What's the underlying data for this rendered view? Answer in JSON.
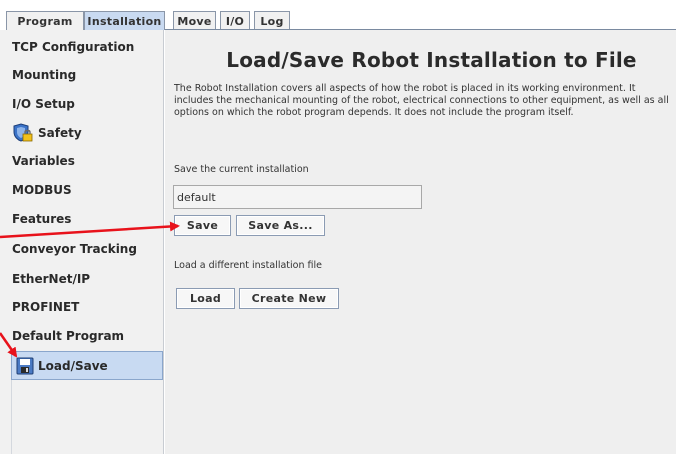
{
  "tabs": [
    {
      "label": "Program",
      "active": false
    },
    {
      "label": "Installation",
      "active": true
    },
    {
      "label": "Move",
      "active": false
    },
    {
      "label": "I/O",
      "active": false
    },
    {
      "label": "Log",
      "active": false
    }
  ],
  "sidebar": {
    "items": [
      {
        "label": "TCP Configuration"
      },
      {
        "label": "Mounting"
      },
      {
        "label": "I/O Setup"
      },
      {
        "label": "Safety",
        "icon": "safety-shield-lock-icon"
      },
      {
        "label": "Variables"
      },
      {
        "label": "MODBUS"
      },
      {
        "label": "Features"
      },
      {
        "label": "Conveyor Tracking"
      },
      {
        "label": "EtherNet/IP"
      },
      {
        "label": "PROFINET"
      },
      {
        "label": "Default Program"
      },
      {
        "label": "Load/Save",
        "icon": "floppy-disk-icon",
        "selected": true
      }
    ]
  },
  "main": {
    "title": "Load/Save Robot Installation to File",
    "description": "The Robot Installation covers all aspects of how the robot is placed in its working environment. It includes the mechanical mounting of the robot, electrical connections to other equipment, as well as all options on which the robot program depends. It does not include the program itself.",
    "save_section_label": "Save the current installation",
    "installation_name": "default",
    "save_button": "Save",
    "save_as_button": "Save As...",
    "load_section_label": "Load a different installation file",
    "load_button": "Load",
    "create_new_button": "Create New"
  },
  "colors": {
    "active_tab": "#c9daf1",
    "selected_item": "#c8daf2",
    "annotation_arrow": "#e8121b",
    "panel_background": "#efefef"
  }
}
